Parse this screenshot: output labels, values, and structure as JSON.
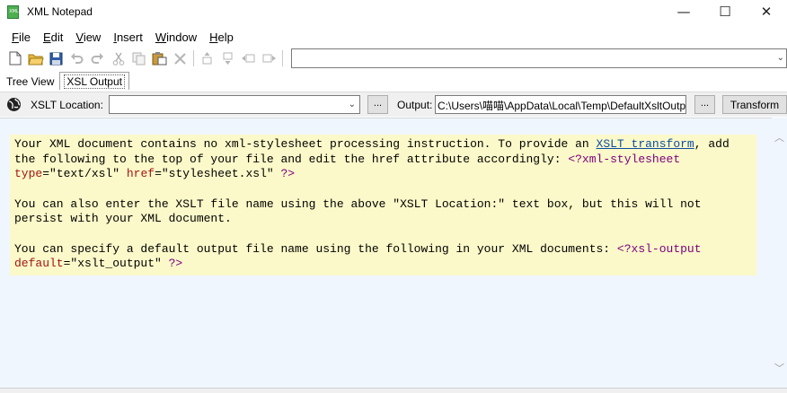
{
  "window": {
    "title": "XML Notepad",
    "minimize": "—",
    "maximize": "☐",
    "close": "✕"
  },
  "menu": {
    "items": [
      {
        "key": "F",
        "rest": "ile"
      },
      {
        "key": "E",
        "rest": "dit"
      },
      {
        "key": "V",
        "rest": "iew"
      },
      {
        "key": "I",
        "rest": "nsert"
      },
      {
        "key": "W",
        "rest": "indow"
      },
      {
        "key": "H",
        "rest": "elp"
      }
    ]
  },
  "toolbar": {
    "location_value": "",
    "icons": [
      "new-file-icon",
      "open-folder-icon",
      "save-icon",
      "undo-icon",
      "redo-icon",
      "cut-icon",
      "copy-icon",
      "paste-icon",
      "delete-icon",
      "nudge-up-icon",
      "nudge-down-icon",
      "nudge-left-icon",
      "nudge-right-icon"
    ]
  },
  "tabs": {
    "tree_view": "Tree View",
    "xsl_output": "XSL Output",
    "active": "xsl_output"
  },
  "xslt": {
    "location_label": "XSLT Location:",
    "location_value": "",
    "browse_label": "...",
    "output_label": "Output:",
    "output_value": "C:\\Users\\喵喵\\AppData\\Local\\Temp\\DefaultXsltOutput",
    "output_browse_label": "...",
    "transform_label": "Transform"
  },
  "message": {
    "p1_a": "Your XML document contains no xml-stylesheet processing instruction. To provide an ",
    "p1_link": "XSLT transform",
    "p1_b": ", add the following to the top of your file and edit the href attribute accordingly: ",
    "p1_pi_open": "<?xml-stylesheet",
    "p1_attr1": " type",
    "p1_val1": "=\"text/xsl\"",
    "p1_attr2": " href",
    "p1_val2": "=\"stylesheet.xsl\"",
    "p1_pi_close": " ?>",
    "p2": "You can also enter the XSLT file name using the above \"XSLT Location:\" text box, but this will not persist with your XML document.",
    "p3_a": "You can specify a default output file name using the following in your XML documents: ",
    "p3_pi_open": "<?xsl-output",
    "p3_attr": " default",
    "p3_val": "=\"xslt_output\"",
    "p3_pi_close": " ?>"
  },
  "colors": {
    "message_bg": "#fbf9c9",
    "content_bg": "#f0f6fd",
    "link": "#0b4ea2",
    "pi": "#800080",
    "attr": "#a31515"
  }
}
